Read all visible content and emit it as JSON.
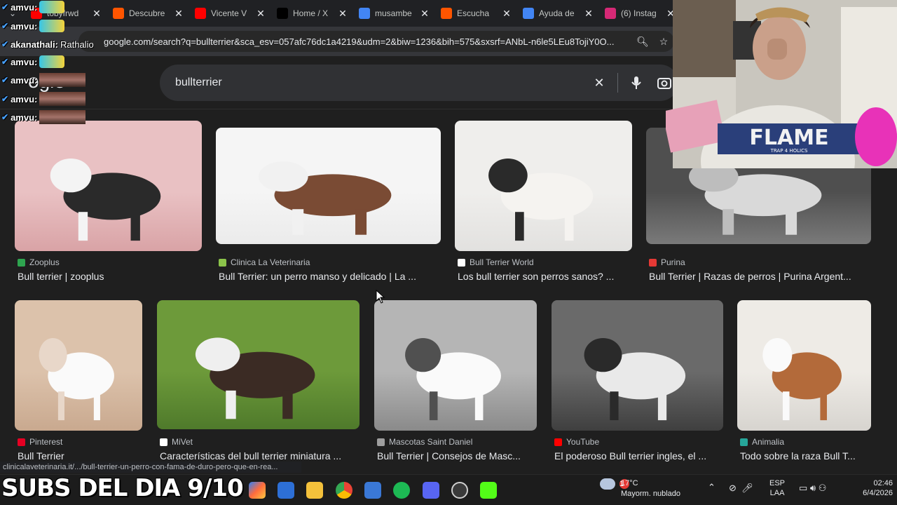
{
  "tabs": [
    {
      "title": "tobyfrwd",
      "favicon_color": "#ff0000",
      "icon": "youtube-icon"
    },
    {
      "title": "Descubre",
      "favicon_color": "#ff5500",
      "icon": "soundcloud-icon"
    },
    {
      "title": "Vicente V",
      "favicon_color": "#ff0000",
      "icon": "youtube-icon"
    },
    {
      "title": "Home / X",
      "favicon_color": "#000000",
      "icon": "x-icon"
    },
    {
      "title": "musambe",
      "favicon_color": "#4285f4",
      "icon": "google-icon"
    },
    {
      "title": "Escucha",
      "favicon_color": "#ff5500",
      "icon": "soundcloud-icon"
    },
    {
      "title": "Ayuda de",
      "favicon_color": "#4285f4",
      "icon": "google-icon"
    },
    {
      "title": "(6) Instag",
      "favicon_color": "#d62976",
      "icon": "instagram-icon"
    }
  ],
  "address_bar": {
    "url": "google.com/search?q=bullterrier&sca_esv=057afc76dc1a4219&udm=2&biw=1236&bih=575&sxsrf=ANbL-n6le5LEu8TojiY0O..."
  },
  "google": {
    "logo_text": "ogle",
    "query": "bullterrier"
  },
  "results": [
    {
      "source": "Zooplus",
      "caption": "Bull terrier | zooplus",
      "fav_color": "#2ea44f"
    },
    {
      "source": "Clinica La Veterinaria",
      "caption": "Bull Terrier: un perro manso y delicado | La ...",
      "fav_color": "#8bc34a"
    },
    {
      "source": "Bull Terrier World",
      "caption": "Los bull terrier son perros sanos? ...",
      "fav_color": "#ffffff"
    },
    {
      "source": "Purina",
      "caption": "Bull Terrier | Razas de perros | Purina Argent...",
      "fav_color": "#e53935"
    },
    {
      "source": "Pinterest",
      "caption": "Bull Terrier",
      "fav_color": "#e60023"
    },
    {
      "source": "MiVet",
      "caption": "Características del bull terrier miniatura ...",
      "fav_color": "#ffffff"
    },
    {
      "source": "Mascotas Saint Daniel",
      "caption": "Bull Terrier | Consejos de Masc...",
      "fav_color": "#9e9e9e"
    },
    {
      "source": "YouTube",
      "caption": "El poderoso Bull terrier ingles, el ...",
      "fav_color": "#ff0000"
    },
    {
      "source": "Animalia",
      "caption": "Todo sobre la raza Bull T...",
      "fav_color": "#26a69a"
    }
  ],
  "status_bar": {
    "text": "clinicalaveterinaria.it/.../bull-terrier-un-perro-con-fama-de-duro-pero-que-en-rea..."
  },
  "chat": [
    {
      "user": "amvu:",
      "emote": "emote"
    },
    {
      "user": "amvu:",
      "emote": "emote"
    },
    {
      "user": "akanathali:",
      "text": "Rathalio"
    },
    {
      "user": "amvu:",
      "emote": "emote"
    },
    {
      "user": "amvu:",
      "emote": "stripe"
    },
    {
      "user": "amvu:",
      "emote": "stripe"
    },
    {
      "user": "amvu:",
      "emote": "stripe"
    }
  ],
  "overlay": {
    "subs_text": "SUBS DEL DIA 9/10",
    "flame_text": "FLAME",
    "flame_sub": "TRAP 4 HOLICS"
  },
  "taskbar": {
    "weather_temp": "17°C",
    "weather_desc": "Mayorm. nublado",
    "weather_badge": "1",
    "lang": "ESP",
    "layout": "LAA",
    "time": "02:46",
    "date": "6/4/2026"
  }
}
